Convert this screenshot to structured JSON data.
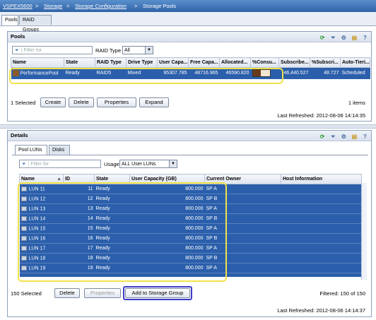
{
  "breadcrumb": {
    "items": [
      "VSPEX5600",
      ">",
      "Storage",
      ">",
      "Storage Configuration",
      ">",
      "Storage Pools"
    ]
  },
  "top_tabs": [
    "Pools",
    "RAID Groups"
  ],
  "pools_panel": {
    "title": "Pools",
    "filter_placeholder": "Filter for",
    "raid_type_label": "RAID Type",
    "raid_type_value": "All",
    "columns": [
      "Name",
      "State",
      "RAID Type",
      "Drive Type",
      "User Capa...",
      "Free Capa...",
      "Allocated...",
      "%Consu...",
      "Subscribe...",
      "%Subscri...",
      "Auto-Tieri..."
    ],
    "rows": [
      {
        "name": "PerformancePool",
        "state": "Ready",
        "raid_type": "RAID5",
        "drive_type": "Mixed",
        "user_capacity": "95307.785",
        "free_capacity": "48716.965",
        "allocated": "46590.820",
        "consumed_fraction": 0.49,
        "subscribed": "46,440.527",
        "pct_subscribed": "48.727",
        "auto_tiering": "Scheduled"
      }
    ],
    "selected_text": "1 Selected",
    "buttons": [
      "Create",
      "Delete",
      "Properties",
      "Expand"
    ],
    "items_count": "1 items",
    "last_refreshed": "Last Refreshed: 2012-08-06 14:14:35"
  },
  "details_panel": {
    "title": "Details",
    "tabs": [
      "Pool LUNs",
      "Disks"
    ],
    "filter_placeholder": "Filter for",
    "usage_label": "Usage",
    "usage_value": "ALL User LUNs",
    "columns": [
      "Name",
      "ID",
      "State",
      "User Capacity (GB)",
      "Current Owner",
      "Host Information"
    ],
    "rows": [
      {
        "name": "LUN 11",
        "id": "11",
        "state": "Ready",
        "capacity": "800.000",
        "owner": "SP A",
        "host": ""
      },
      {
        "name": "LUN 12",
        "id": "12",
        "state": "Ready",
        "capacity": "800.000",
        "owner": "SP B",
        "host": ""
      },
      {
        "name": "LUN 13",
        "id": "13",
        "state": "Ready",
        "capacity": "800.000",
        "owner": "SP A",
        "host": ""
      },
      {
        "name": "LUN 14",
        "id": "14",
        "state": "Ready",
        "capacity": "800.000",
        "owner": "SP B",
        "host": ""
      },
      {
        "name": "LUN 15",
        "id": "15",
        "state": "Ready",
        "capacity": "800.000",
        "owner": "SP A",
        "host": ""
      },
      {
        "name": "LUN 16",
        "id": "16",
        "state": "Ready",
        "capacity": "800.000",
        "owner": "SP B",
        "host": ""
      },
      {
        "name": "LUN 17",
        "id": "17",
        "state": "Ready",
        "capacity": "800.000",
        "owner": "SP A",
        "host": ""
      },
      {
        "name": "LUN 18",
        "id": "18",
        "state": "Ready",
        "capacity": "800.000",
        "owner": "SP B",
        "host": ""
      },
      {
        "name": "LUN 19",
        "id": "19",
        "state": "Ready",
        "capacity": "800.000",
        "owner": "SP A",
        "host": ""
      }
    ],
    "selected_text": "150 Selected",
    "buttons": [
      "Delete",
      "Properties",
      "Add to Storage Group"
    ],
    "filtered_text": "Filtered: 150 of 150",
    "last_refreshed": "Last Refreshed: 2012-08-06 14:14:37"
  },
  "colors": {
    "selection": "#2b5fab",
    "highlight_yellow": "#f2e14a",
    "highlight_blue": "#3c3cc8"
  }
}
